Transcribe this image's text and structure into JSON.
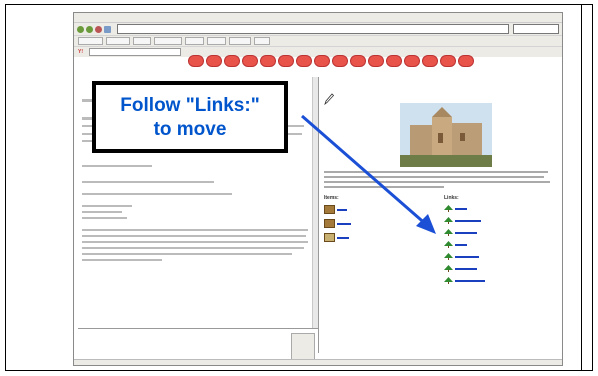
{
  "callout": {
    "line1": "Follow \"Links:\"",
    "line2": "to move"
  },
  "colors": {
    "callout_text": "#0055cc",
    "arrow": "#1a4fd6",
    "toolbar_buttons": "#e8534a"
  },
  "right_pane": {
    "heading_items": "Items:",
    "heading_links": "Links:"
  },
  "icons": {
    "arrow": "arrow-icon",
    "pencil": "pencil-icon",
    "tree": "tree-icon",
    "item": "item-icon"
  }
}
